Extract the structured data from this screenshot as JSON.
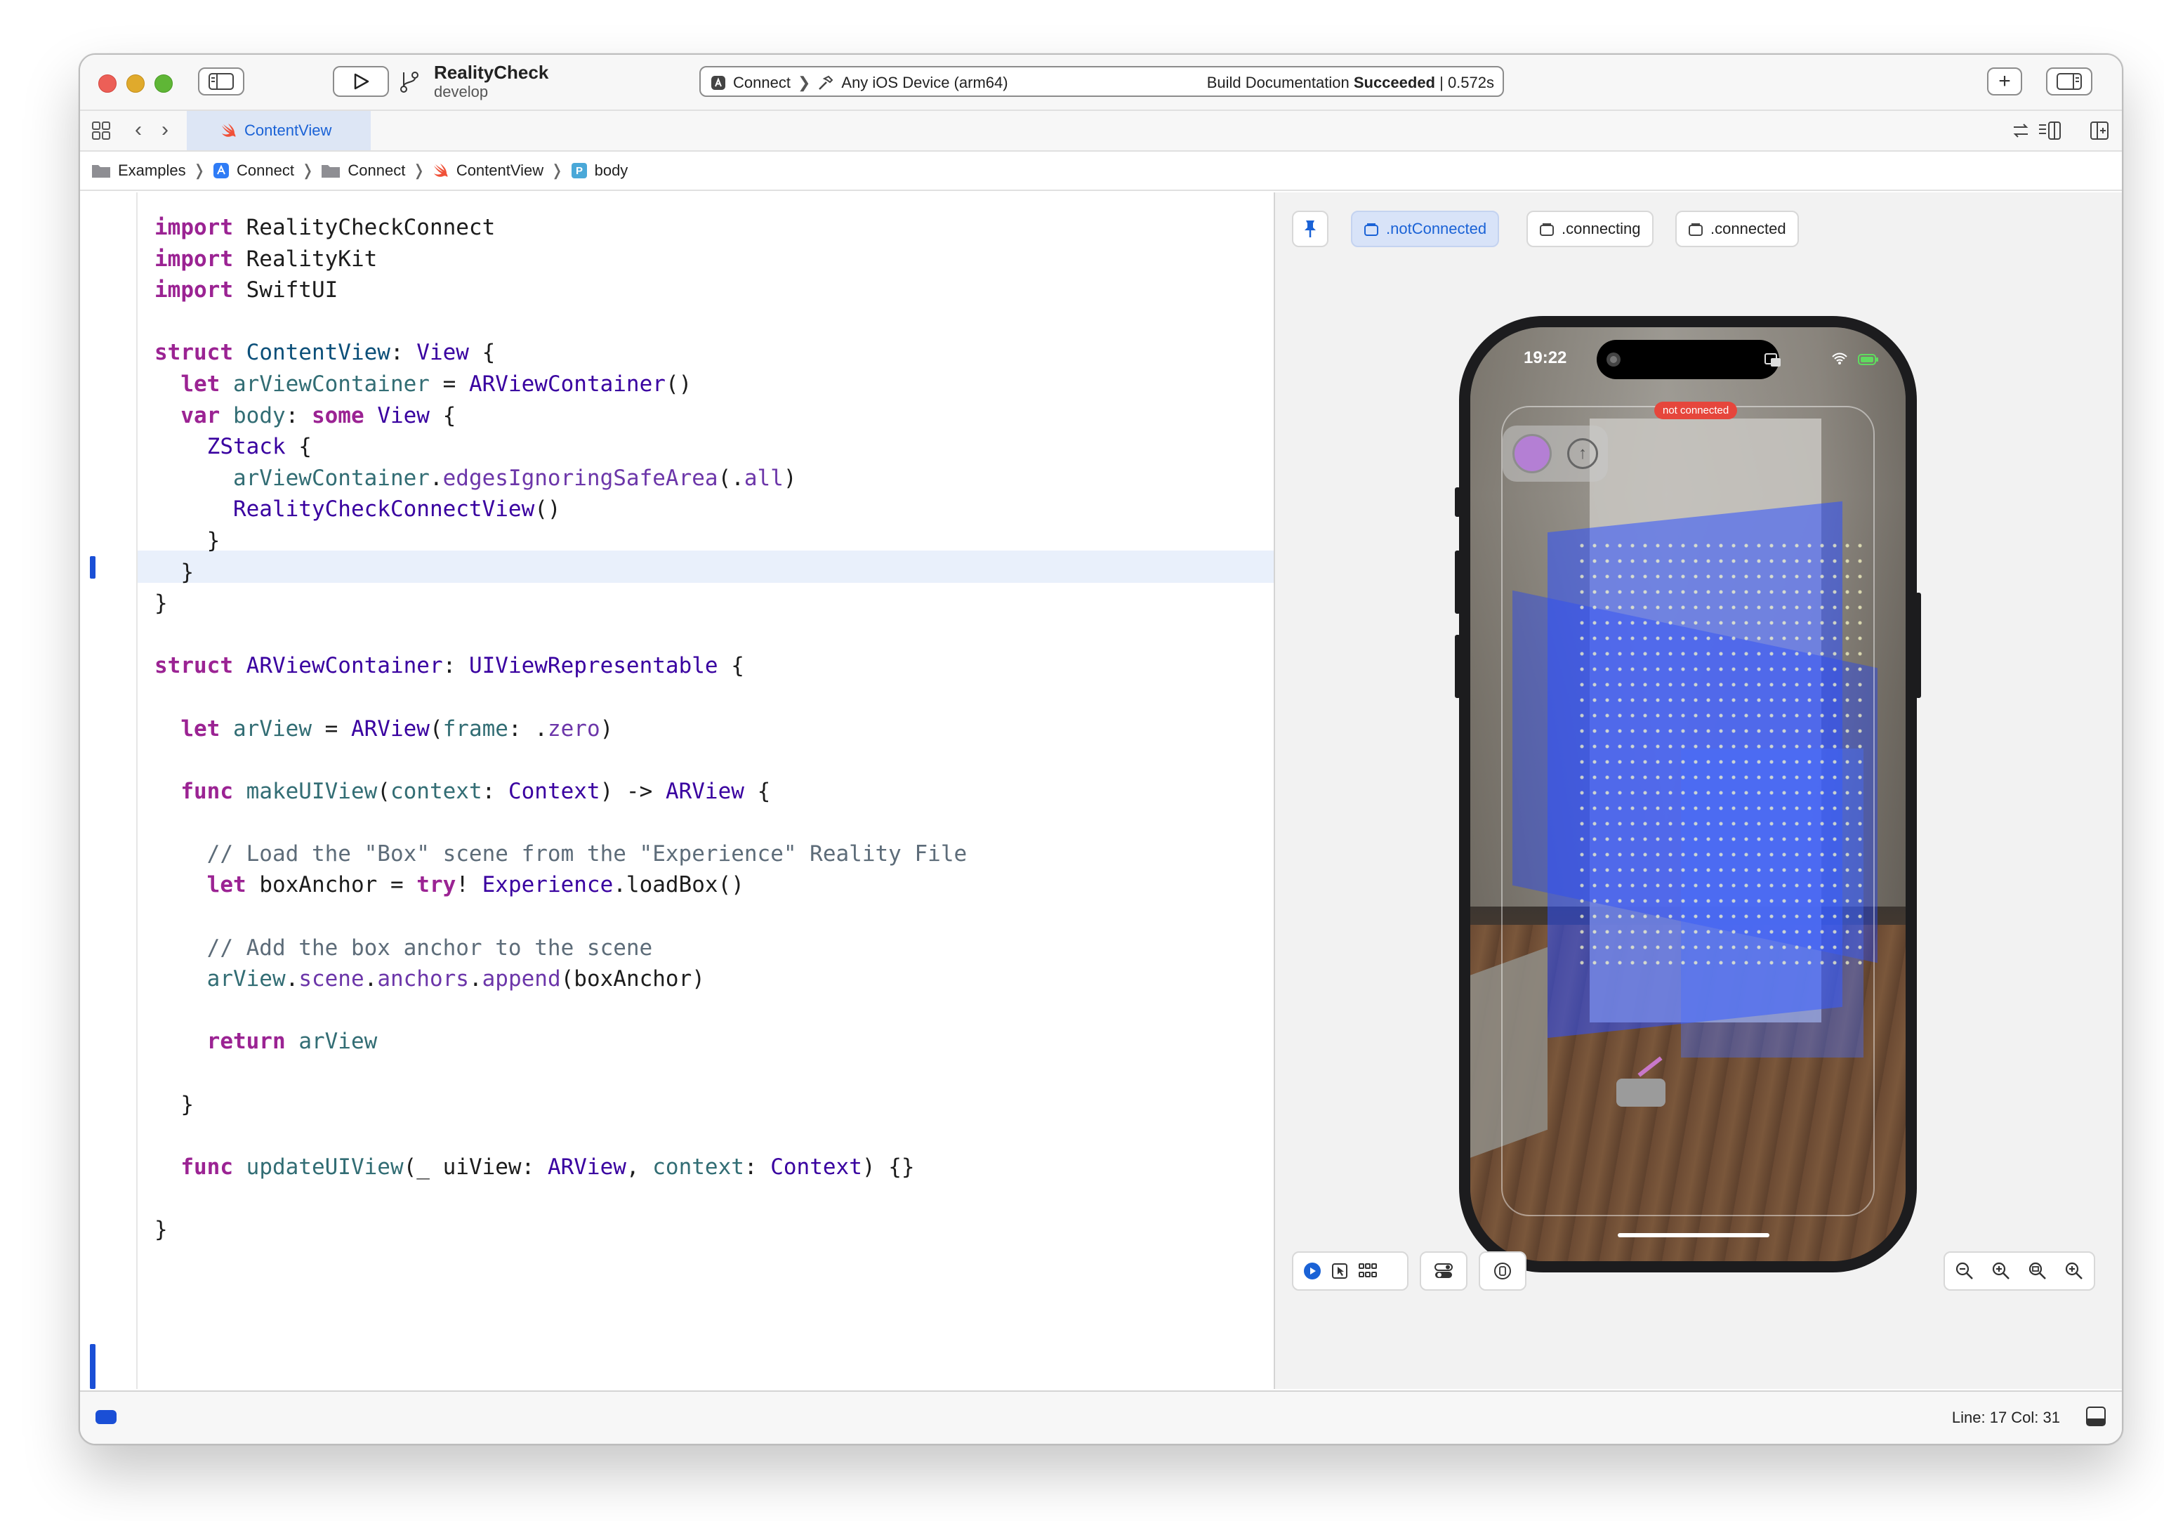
{
  "window": {
    "project_name": "RealityCheck",
    "branch": "develop"
  },
  "activity": {
    "scheme": "Connect",
    "device": "Any iOS Device (arm64)",
    "status_prefix": "Build Documentation ",
    "status_bold": "Succeeded",
    "status_suffix": " | 0.572s"
  },
  "tabs": [
    {
      "label": "ContentView",
      "active": true
    }
  ],
  "breadcrumbs": [
    {
      "label": "Examples",
      "icon": "folder-icon"
    },
    {
      "label": "Connect",
      "icon": "app-target-icon"
    },
    {
      "label": "Connect",
      "icon": "folder-icon"
    },
    {
      "label": "ContentView",
      "icon": "swift-file-icon"
    },
    {
      "label": "body",
      "icon": "property-icon"
    }
  ],
  "code_lines": [
    "import RealityCheckConnect",
    "import RealityKit",
    "import SwiftUI",
    "",
    "struct ContentView: View {",
    "  let arViewContainer = ARViewContainer()",
    "  var body: some View {",
    "    ZStack {",
    "      arViewContainer.edgesIgnoringSafeArea(.all)",
    "      RealityCheckConnectView()",
    "    }",
    "  }",
    "}",
    "",
    "struct ARViewContainer: UIViewRepresentable {",
    "",
    "  let arView = ARView(frame: .zero)",
    "",
    "  func makeUIView(context: Context) -> ARView {",
    "",
    "    // Load the \"Box\" scene from the \"Experience\" Reality File",
    "    let boxAnchor = try! Experience.loadBox()",
    "",
    "    // Add the box anchor to the scene",
    "    arView.scene.anchors.append(boxAnchor)",
    "",
    "    return arView",
    "",
    "  }",
    "",
    "  func updateUIView(_ uiView: ARView, context: Context) {}",
    "",
    "}"
  ],
  "preview": {
    "variants": [
      {
        "label": ".notConnected",
        "selected": true
      },
      {
        "label": ".connecting",
        "selected": false
      },
      {
        "label": ".connected",
        "selected": false
      }
    ],
    "phone_time": "19:22",
    "connection_badge": "not connected"
  },
  "status": {
    "line_col": "Line: 17  Col: 31"
  },
  "colors": {
    "accent": "#1a62d6",
    "keyword": "#9b2393",
    "badge_red": "#e6463c"
  }
}
